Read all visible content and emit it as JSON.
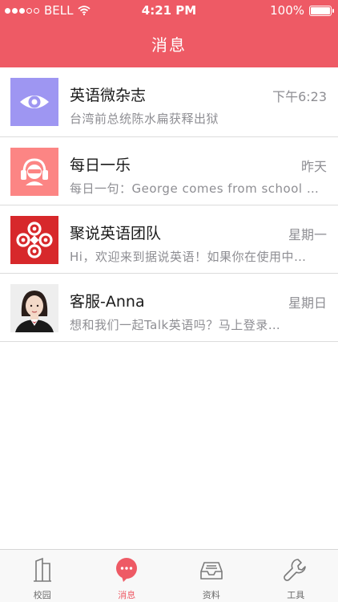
{
  "status_bar": {
    "carrier": "BELL",
    "time": "4:21 PM",
    "battery": "100%",
    "signal_bars_filled": 3,
    "signal_bars_total": 5
  },
  "header": {
    "title": "消息"
  },
  "conversations": [
    {
      "name": "英语微杂志",
      "time": "下午6:23",
      "preview": "台湾前总统陈水扁获释出狱",
      "avatar_icon": "eye-icon"
    },
    {
      "name": "每日一乐",
      "time": "昨天",
      "preview": "每日一句：George comes from school …",
      "avatar_icon": "headphones-person-icon"
    },
    {
      "name": "聚说英语团队",
      "time": "星期一",
      "preview": "Hi，欢迎来到据说英语！如果你在使用中…",
      "avatar_icon": "swirl-logo-icon"
    },
    {
      "name": "客服-Anna",
      "time": "星期日",
      "preview": "想和我们一起Talk英语吗？马上登录…",
      "avatar_icon": "agent-photo"
    }
  ],
  "tabbar": {
    "tabs": [
      {
        "label": "校园",
        "icon": "building-icon"
      },
      {
        "label": "消息",
        "icon": "chat-bubble-icon",
        "active": true
      },
      {
        "label": "资料",
        "icon": "inbox-tray-icon"
      },
      {
        "label": "工具",
        "icon": "wrench-icon"
      }
    ]
  },
  "colors": {
    "accent": "#ee5a65",
    "eye_avatar_bg": "#9e96f2",
    "joke_avatar_bg": "#fc8584",
    "logo_avatar_bg": "#d7282b"
  }
}
